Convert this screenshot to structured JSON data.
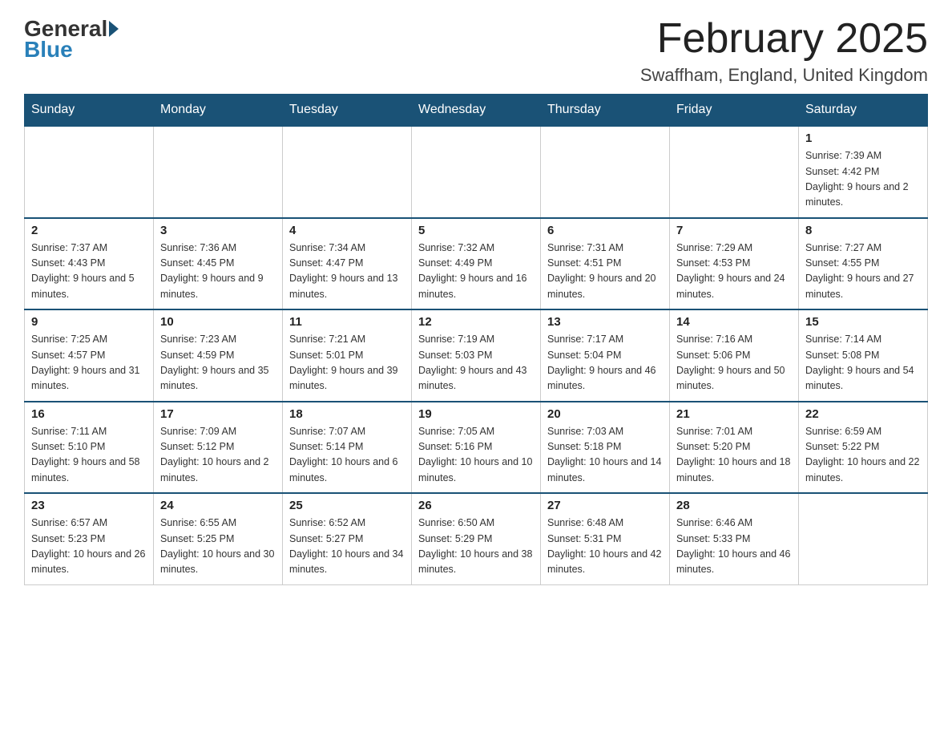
{
  "header": {
    "logo_general": "General",
    "logo_blue": "Blue",
    "month_title": "February 2025",
    "location": "Swaffham, England, United Kingdom"
  },
  "days_of_week": [
    "Sunday",
    "Monday",
    "Tuesday",
    "Wednesday",
    "Thursday",
    "Friday",
    "Saturday"
  ],
  "weeks": [
    [
      {
        "day": "",
        "sunrise": "",
        "sunset": "",
        "daylight": ""
      },
      {
        "day": "",
        "sunrise": "",
        "sunset": "",
        "daylight": ""
      },
      {
        "day": "",
        "sunrise": "",
        "sunset": "",
        "daylight": ""
      },
      {
        "day": "",
        "sunrise": "",
        "sunset": "",
        "daylight": ""
      },
      {
        "day": "",
        "sunrise": "",
        "sunset": "",
        "daylight": ""
      },
      {
        "day": "",
        "sunrise": "",
        "sunset": "",
        "daylight": ""
      },
      {
        "day": "1",
        "sunrise": "Sunrise: 7:39 AM",
        "sunset": "Sunset: 4:42 PM",
        "daylight": "Daylight: 9 hours and 2 minutes."
      }
    ],
    [
      {
        "day": "2",
        "sunrise": "Sunrise: 7:37 AM",
        "sunset": "Sunset: 4:43 PM",
        "daylight": "Daylight: 9 hours and 5 minutes."
      },
      {
        "day": "3",
        "sunrise": "Sunrise: 7:36 AM",
        "sunset": "Sunset: 4:45 PM",
        "daylight": "Daylight: 9 hours and 9 minutes."
      },
      {
        "day": "4",
        "sunrise": "Sunrise: 7:34 AM",
        "sunset": "Sunset: 4:47 PM",
        "daylight": "Daylight: 9 hours and 13 minutes."
      },
      {
        "day": "5",
        "sunrise": "Sunrise: 7:32 AM",
        "sunset": "Sunset: 4:49 PM",
        "daylight": "Daylight: 9 hours and 16 minutes."
      },
      {
        "day": "6",
        "sunrise": "Sunrise: 7:31 AM",
        "sunset": "Sunset: 4:51 PM",
        "daylight": "Daylight: 9 hours and 20 minutes."
      },
      {
        "day": "7",
        "sunrise": "Sunrise: 7:29 AM",
        "sunset": "Sunset: 4:53 PM",
        "daylight": "Daylight: 9 hours and 24 minutes."
      },
      {
        "day": "8",
        "sunrise": "Sunrise: 7:27 AM",
        "sunset": "Sunset: 4:55 PM",
        "daylight": "Daylight: 9 hours and 27 minutes."
      }
    ],
    [
      {
        "day": "9",
        "sunrise": "Sunrise: 7:25 AM",
        "sunset": "Sunset: 4:57 PM",
        "daylight": "Daylight: 9 hours and 31 minutes."
      },
      {
        "day": "10",
        "sunrise": "Sunrise: 7:23 AM",
        "sunset": "Sunset: 4:59 PM",
        "daylight": "Daylight: 9 hours and 35 minutes."
      },
      {
        "day": "11",
        "sunrise": "Sunrise: 7:21 AM",
        "sunset": "Sunset: 5:01 PM",
        "daylight": "Daylight: 9 hours and 39 minutes."
      },
      {
        "day": "12",
        "sunrise": "Sunrise: 7:19 AM",
        "sunset": "Sunset: 5:03 PM",
        "daylight": "Daylight: 9 hours and 43 minutes."
      },
      {
        "day": "13",
        "sunrise": "Sunrise: 7:17 AM",
        "sunset": "Sunset: 5:04 PM",
        "daylight": "Daylight: 9 hours and 46 minutes."
      },
      {
        "day": "14",
        "sunrise": "Sunrise: 7:16 AM",
        "sunset": "Sunset: 5:06 PM",
        "daylight": "Daylight: 9 hours and 50 minutes."
      },
      {
        "day": "15",
        "sunrise": "Sunrise: 7:14 AM",
        "sunset": "Sunset: 5:08 PM",
        "daylight": "Daylight: 9 hours and 54 minutes."
      }
    ],
    [
      {
        "day": "16",
        "sunrise": "Sunrise: 7:11 AM",
        "sunset": "Sunset: 5:10 PM",
        "daylight": "Daylight: 9 hours and 58 minutes."
      },
      {
        "day": "17",
        "sunrise": "Sunrise: 7:09 AM",
        "sunset": "Sunset: 5:12 PM",
        "daylight": "Daylight: 10 hours and 2 minutes."
      },
      {
        "day": "18",
        "sunrise": "Sunrise: 7:07 AM",
        "sunset": "Sunset: 5:14 PM",
        "daylight": "Daylight: 10 hours and 6 minutes."
      },
      {
        "day": "19",
        "sunrise": "Sunrise: 7:05 AM",
        "sunset": "Sunset: 5:16 PM",
        "daylight": "Daylight: 10 hours and 10 minutes."
      },
      {
        "day": "20",
        "sunrise": "Sunrise: 7:03 AM",
        "sunset": "Sunset: 5:18 PM",
        "daylight": "Daylight: 10 hours and 14 minutes."
      },
      {
        "day": "21",
        "sunrise": "Sunrise: 7:01 AM",
        "sunset": "Sunset: 5:20 PM",
        "daylight": "Daylight: 10 hours and 18 minutes."
      },
      {
        "day": "22",
        "sunrise": "Sunrise: 6:59 AM",
        "sunset": "Sunset: 5:22 PM",
        "daylight": "Daylight: 10 hours and 22 minutes."
      }
    ],
    [
      {
        "day": "23",
        "sunrise": "Sunrise: 6:57 AM",
        "sunset": "Sunset: 5:23 PM",
        "daylight": "Daylight: 10 hours and 26 minutes."
      },
      {
        "day": "24",
        "sunrise": "Sunrise: 6:55 AM",
        "sunset": "Sunset: 5:25 PM",
        "daylight": "Daylight: 10 hours and 30 minutes."
      },
      {
        "day": "25",
        "sunrise": "Sunrise: 6:52 AM",
        "sunset": "Sunset: 5:27 PM",
        "daylight": "Daylight: 10 hours and 34 minutes."
      },
      {
        "day": "26",
        "sunrise": "Sunrise: 6:50 AM",
        "sunset": "Sunset: 5:29 PM",
        "daylight": "Daylight: 10 hours and 38 minutes."
      },
      {
        "day": "27",
        "sunrise": "Sunrise: 6:48 AM",
        "sunset": "Sunset: 5:31 PM",
        "daylight": "Daylight: 10 hours and 42 minutes."
      },
      {
        "day": "28",
        "sunrise": "Sunrise: 6:46 AM",
        "sunset": "Sunset: 5:33 PM",
        "daylight": "Daylight: 10 hours and 46 minutes."
      },
      {
        "day": "",
        "sunrise": "",
        "sunset": "",
        "daylight": ""
      }
    ]
  ]
}
